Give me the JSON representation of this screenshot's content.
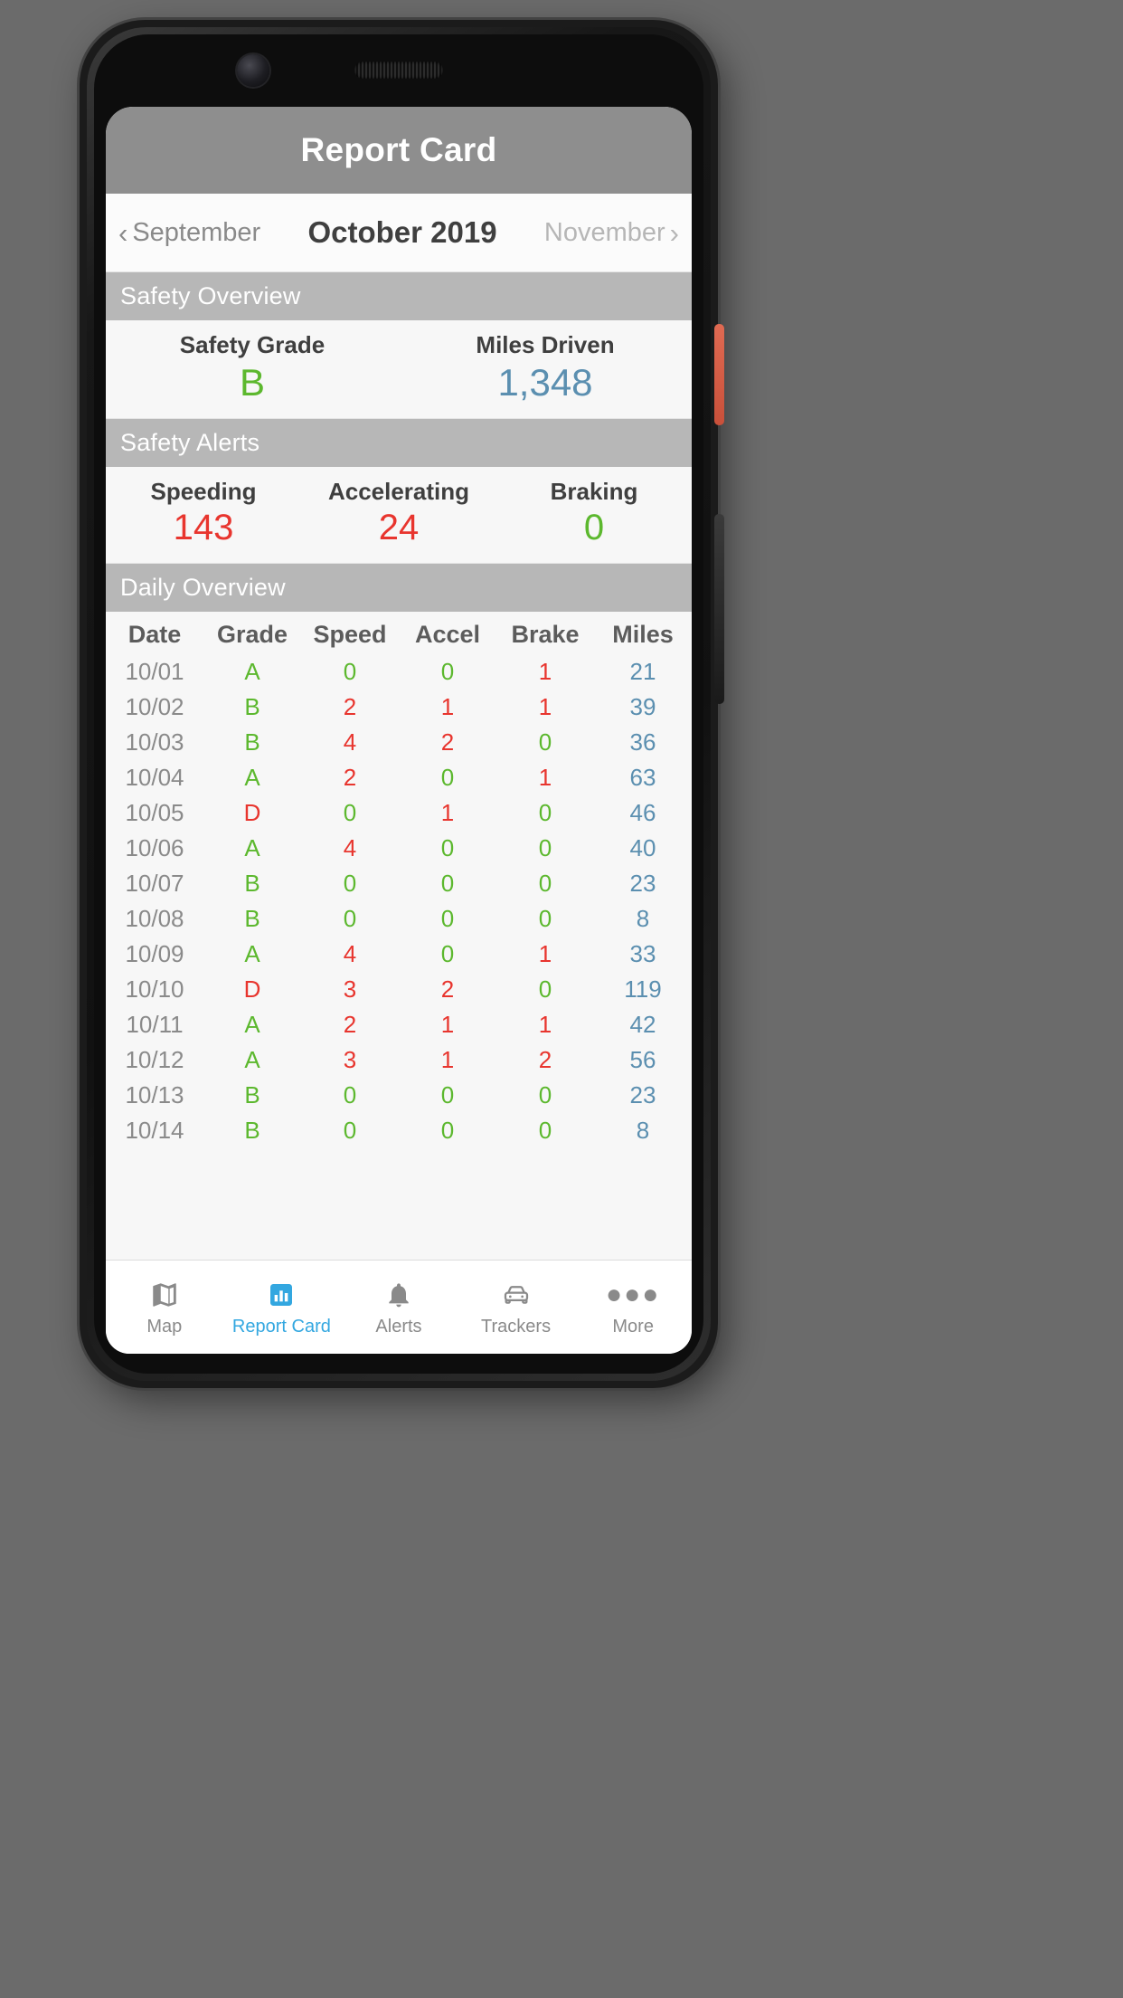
{
  "app": {
    "title": "Report Card"
  },
  "month_nav": {
    "prev_label": "September",
    "current_label": "October 2019",
    "next_label": "November",
    "prev_chevron": "chevron-left-icon",
    "next_chevron": "chevron-right-icon"
  },
  "sections": {
    "safety_overview": {
      "header": "Safety Overview",
      "stats": [
        {
          "label": "Safety Grade",
          "value": "B",
          "color": "#5cb82e"
        },
        {
          "label": "Miles Driven",
          "value": "1,348",
          "color": "#5b8fb0"
        }
      ]
    },
    "safety_alerts": {
      "header": "Safety Alerts",
      "stats": [
        {
          "label": "Speeding",
          "value": "143",
          "color": "#e8352e"
        },
        {
          "label": "Accelerating",
          "value": "24",
          "color": "#e8352e"
        },
        {
          "label": "Braking",
          "value": "0",
          "color": "#5cb82e"
        }
      ]
    },
    "daily_overview": {
      "header": "Daily Overview",
      "columns": [
        "Date",
        "Grade",
        "Speed",
        "Accel",
        "Brake",
        "Miles"
      ],
      "rows": [
        {
          "date": "10/01",
          "grade": "A",
          "speed": "0",
          "accel": "0",
          "brake": "1",
          "miles": "21"
        },
        {
          "date": "10/02",
          "grade": "B",
          "speed": "2",
          "accel": "1",
          "brake": "1",
          "miles": "39"
        },
        {
          "date": "10/03",
          "grade": "B",
          "speed": "4",
          "accel": "2",
          "brake": "0",
          "miles": "36"
        },
        {
          "date": "10/04",
          "grade": "A",
          "speed": "2",
          "accel": "0",
          "brake": "1",
          "miles": "63"
        },
        {
          "date": "10/05",
          "grade": "D",
          "speed": "0",
          "accel": "1",
          "brake": "0",
          "miles": "46"
        },
        {
          "date": "10/06",
          "grade": "A",
          "speed": "4",
          "accel": "0",
          "brake": "0",
          "miles": "40"
        },
        {
          "date": "10/07",
          "grade": "B",
          "speed": "0",
          "accel": "0",
          "brake": "0",
          "miles": "23"
        },
        {
          "date": "10/08",
          "grade": "B",
          "speed": "0",
          "accel": "0",
          "brake": "0",
          "miles": "8"
        },
        {
          "date": "10/09",
          "grade": "A",
          "speed": "4",
          "accel": "0",
          "brake": "1",
          "miles": "33"
        },
        {
          "date": "10/10",
          "grade": "D",
          "speed": "3",
          "accel": "2",
          "brake": "0",
          "miles": "119"
        },
        {
          "date": "10/11",
          "grade": "A",
          "speed": "2",
          "accel": "1",
          "brake": "1",
          "miles": "42"
        },
        {
          "date": "10/12",
          "grade": "A",
          "speed": "3",
          "accel": "1",
          "brake": "2",
          "miles": "56"
        },
        {
          "date": "10/13",
          "grade": "B",
          "speed": "0",
          "accel": "0",
          "brake": "0",
          "miles": "23"
        },
        {
          "date": "10/14",
          "grade": "B",
          "speed": "0",
          "accel": "0",
          "brake": "0",
          "miles": "8"
        }
      ]
    }
  },
  "tab_bar": {
    "items": [
      {
        "label": "Map",
        "icon": "map-icon",
        "active": false
      },
      {
        "label": "Report Card",
        "icon": "bar-chart-icon",
        "active": true
      },
      {
        "label": "Alerts",
        "icon": "bell-icon",
        "active": false
      },
      {
        "label": "Trackers",
        "icon": "car-icon",
        "active": false
      },
      {
        "label": "More",
        "icon": "ellipsis-icon",
        "active": false
      }
    ]
  },
  "colors": {
    "good": "#5cb82e",
    "bad": "#e8352e",
    "miles": "#5b8fb0",
    "accent": "#33a7e0",
    "section_header_bg": "#b7b7b7",
    "app_bar_bg": "#8e8e8e"
  }
}
